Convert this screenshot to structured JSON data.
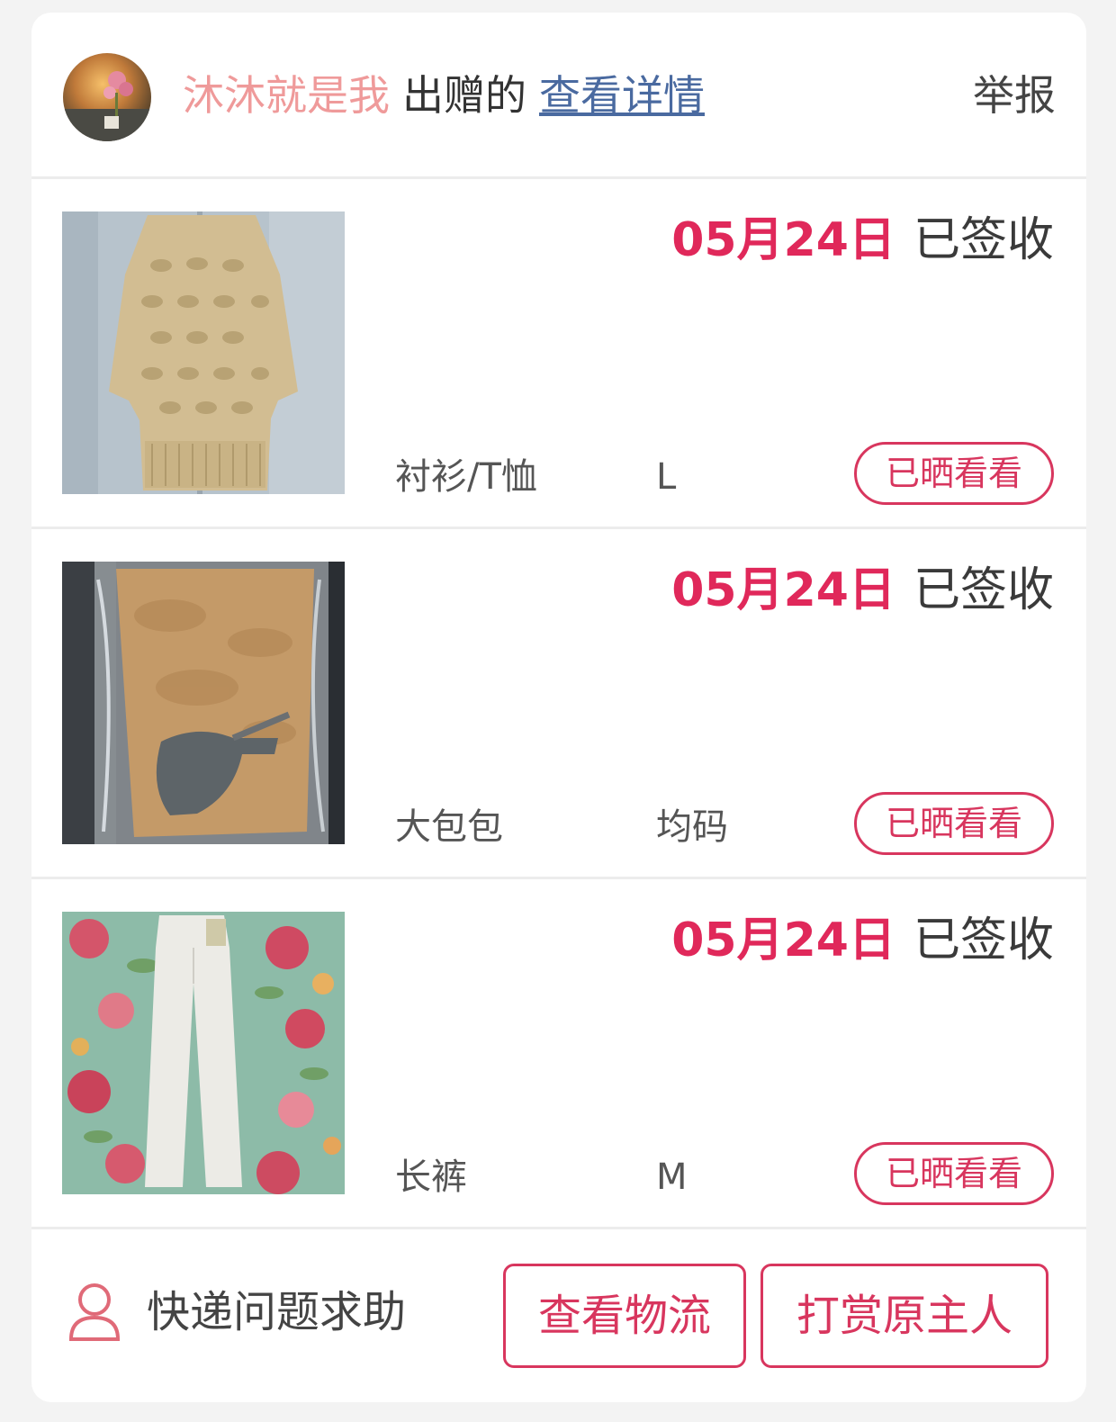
{
  "header": {
    "username": "沐沐就是我",
    "verb": "出赠的",
    "detail_link": "查看详情",
    "report": "举报"
  },
  "items": [
    {
      "date": "05月24日",
      "status": "已签收",
      "category": "衬衫/T恤",
      "size": "L",
      "button": "已晒看看",
      "image": "beige-knit-sweater"
    },
    {
      "date": "05月24日",
      "status": "已签收",
      "category": "大包包",
      "size": "均码",
      "button": "已晒看看",
      "image": "packaged-bag"
    },
    {
      "date": "05月24日",
      "status": "已签收",
      "category": "长裤",
      "size": "M",
      "button": "已晒看看",
      "image": "white-pants-on-floral-fabric"
    }
  ],
  "footer": {
    "help_icon": "person-icon",
    "help_text": "快递问题求助",
    "logistics_button": "查看物流",
    "tip_button": "打赏原主人"
  },
  "colors": {
    "accent": "#e0285a",
    "username": "#ef9a9a",
    "link": "#4a6aa0"
  }
}
